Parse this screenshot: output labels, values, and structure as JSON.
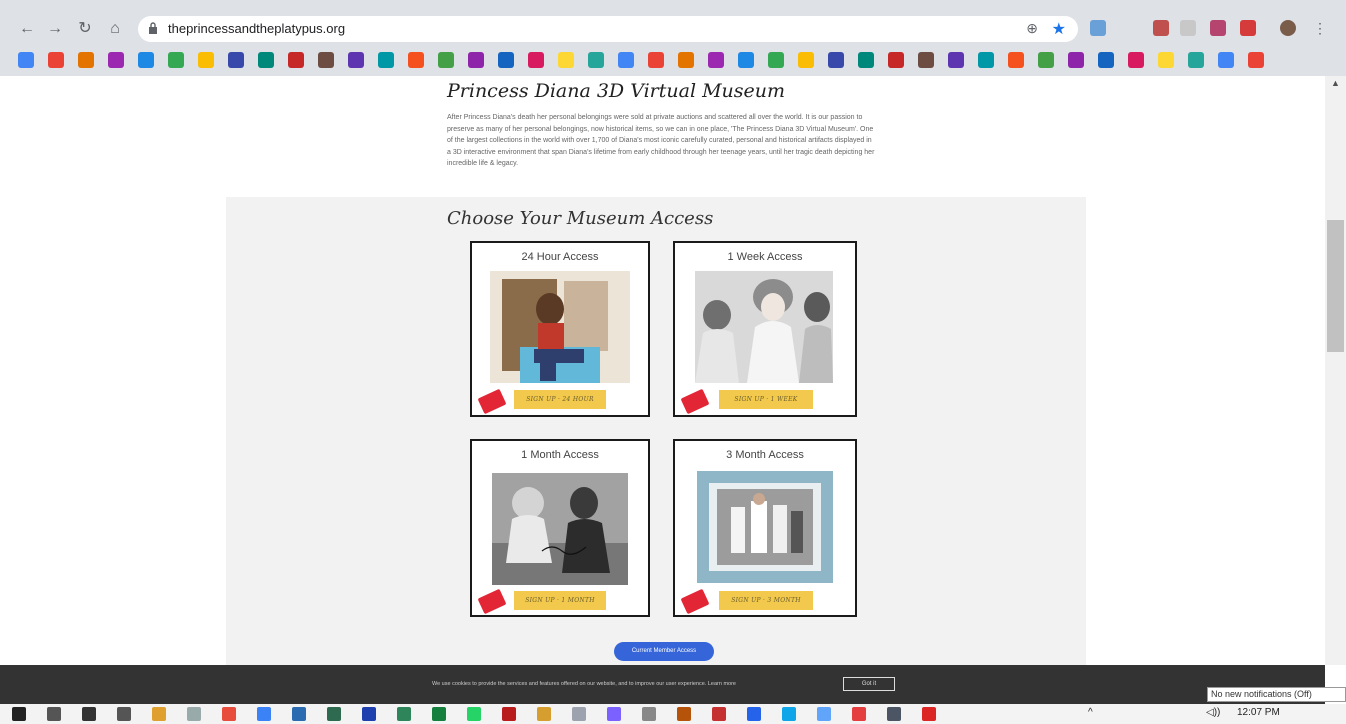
{
  "browser": {
    "url": "theprincessandtheplatypus.org",
    "back_label": "←",
    "forward_label": "→",
    "reload_label": "↻",
    "home_label": "⌂",
    "zoom_label": "⊕",
    "star_label": "★"
  },
  "page": {
    "title": "Princess Diana 3D Virtual Museum",
    "intro": "After Princess Diana's death her personal belongings were sold at private auctions and scattered all over the world. It is our passion to preserve as many of her personal belongings, now historical items, so we can in one place, 'The Princess Diana 3D Virtual Museum'. One of the largest collections in the world with over 1,700 of Diana's most iconic carefully curated, personal and historical artifacts displayed in a 3D interactive environment that span Diana's lifetime from early childhood through her teenage years, until her tragic death depicting her incredible life & legacy.",
    "access_title": "Choose Your Museum Access",
    "cards": [
      {
        "title": "24 Hour Access",
        "button": "SIGN UP · 24 HOUR"
      },
      {
        "title": "1 Week Access",
        "button": "SIGN UP · 1 WEEK"
      },
      {
        "title": "1 Month Access",
        "button": "SIGN UP · 1 MONTH"
      },
      {
        "title": "3 Month Access",
        "button": "SIGN UP · 3 MONTH"
      }
    ],
    "member_button": "Current Member Access"
  },
  "cookie": {
    "text": "We use cookies to provide the services and features offered on our website, and to improve our user experience. Learn more",
    "button": "Got it"
  },
  "notification": "No new notifications (Off)",
  "taskbar": {
    "time": "12:07 PM",
    "volume": "◁))",
    "caret": "^"
  },
  "colors": {
    "signup": "#f2c94c",
    "member_button": "#3565d9",
    "ticket": "#e32636"
  }
}
